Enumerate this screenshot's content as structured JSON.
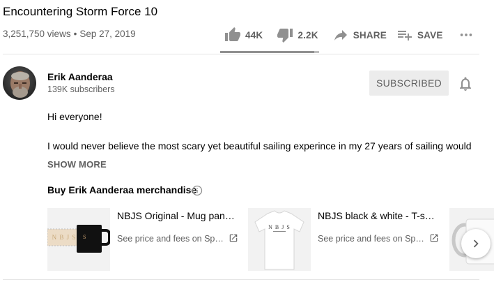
{
  "video": {
    "title": "Encountering Storm Force 10",
    "views": "3,251,750 views",
    "separator": "•",
    "date": "Sep 27, 2019"
  },
  "actions": {
    "like": {
      "icon": "thumb-up-icon",
      "count": "44K"
    },
    "dislike": {
      "icon": "thumb-down-icon",
      "count": "2.2K"
    },
    "share": {
      "icon": "share-icon",
      "label": "SHARE"
    },
    "save": {
      "icon": "playlist-add-icon",
      "label": "SAVE"
    },
    "more": {
      "icon": "more-horizontal-icon"
    },
    "like_ratio": 0.95
  },
  "channel": {
    "name": "Erik Aanderaa",
    "subscribers": "139K subscribers",
    "subscribe_label": "SUBSCRIBED",
    "bell_icon": "notification-bell-icon"
  },
  "description": {
    "greeting": "Hi everyone!",
    "line": "I would never believe the most scary yet beautiful sailing experince in my 27 years of sailing would",
    "show_more": "SHOW MORE"
  },
  "merch": {
    "heading": "Buy Erik Aanderaa merchandise",
    "info_icon": "info-icon",
    "items": [
      {
        "title": "NBJS Original - Mug panoramic black",
        "price": "See price and fees on Spreadshirt",
        "thumb": "mug-panorama-image",
        "print": "N B J S"
      },
      {
        "title": "NBJS black & white - T-shirt",
        "price": "See price and fees on Spreadshirt",
        "thumb": "tshirt-image",
        "print": "N B J S"
      },
      {
        "title": "",
        "price": "",
        "thumb": "mug-white-image"
      }
    ],
    "external_icon": "open-external-icon",
    "next_icon": "chevron-right-icon"
  },
  "colors": {
    "text_primary": "#030303",
    "text_secondary": "#606060",
    "icon_grey": "#909090",
    "button_grey": "#ececec"
  }
}
